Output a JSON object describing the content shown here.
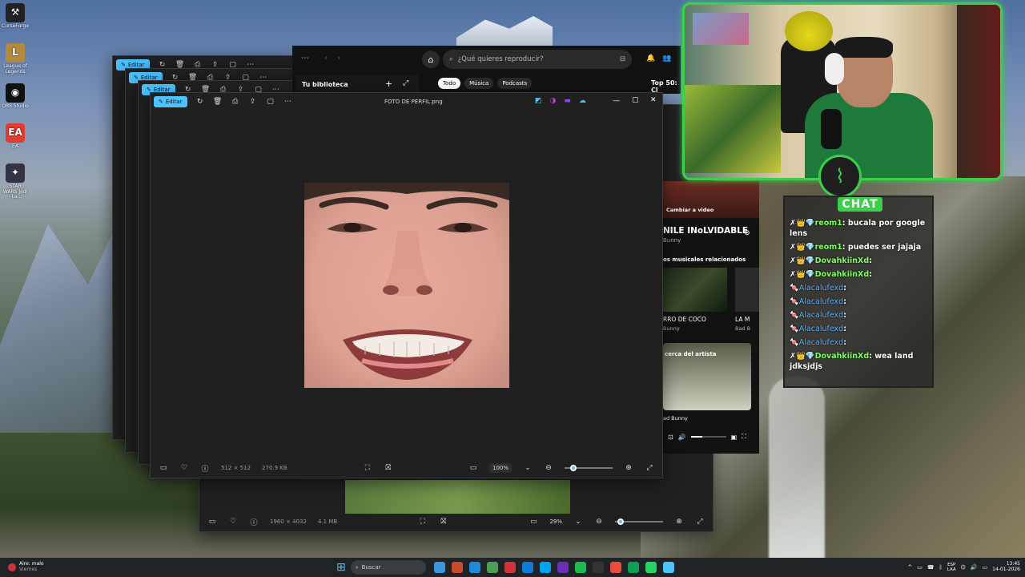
{
  "desktop": {
    "icons": [
      {
        "label": "CurseForge",
        "glyph": "⚒",
        "color": "#222"
      },
      {
        "label": "League of Legends",
        "glyph": "L",
        "color": "#b38b3e"
      },
      {
        "label": "OBS Studio",
        "glyph": "◉",
        "color": "#111"
      },
      {
        "label": "EA",
        "glyph": "EA",
        "color": "#e53b2e"
      },
      {
        "label": "STAR WARS Jedi - La...",
        "glyph": "✦",
        "color": "#334"
      }
    ]
  },
  "viewer_front": {
    "edit_label": "Editar",
    "title": "FOTO DE PERFIL.png",
    "dimensions": "512 × 512",
    "size": "270.9 KB",
    "zoom": "100%",
    "zoom_level": 0.12
  },
  "viewer_back": {
    "dimensions": "1960 × 4032",
    "size": "4.1 MB",
    "zoom": "29%",
    "zoom_level": 0.05
  },
  "viewer_stack_edit": [
    "Editar",
    "Editar",
    "Editar"
  ],
  "spotify": {
    "search_placeholder": "¿Qué quieres reproducir?",
    "library": "Tu biblioteca",
    "chips": [
      "Todo",
      "Música",
      "Podcasts"
    ],
    "top50": "Top 50: Cl",
    "change_video": "Cambiar a video",
    "song_title": "NILE INoLVIDABLE",
    "artist": "Bunny",
    "related": "os musicales relacionados",
    "card1_title": "RRO DE COCO",
    "card1_artist": "Bunny",
    "card2_title": "LA M",
    "card2_artist": "Bad B",
    "about_artist": "cerca del artista",
    "footer_artist": "ad Bunny"
  },
  "chat": {
    "title": "CHAT",
    "messages": [
      {
        "badges": "✗👑💎",
        "user": "reom1",
        "text": ": bucala por google lens",
        "color": "green"
      },
      {
        "badges": "✗👑💎",
        "user": "reom1",
        "text": ": puedes ser jajaja",
        "color": "green"
      },
      {
        "badges": "✗👑💎",
        "user": "DovahkiinXd",
        "text": ": ",
        "color": "green"
      },
      {
        "badges": "✗👑💎",
        "user": "DovahkiinXd",
        "text": ": ",
        "color": "green"
      },
      {
        "badges": "🍬",
        "user": "Alacalufexd",
        "text": ": ",
        "color": "blue"
      },
      {
        "badges": "🍬",
        "user": "Alacalufexd",
        "text": ": ",
        "color": "blue"
      },
      {
        "badges": "🍬",
        "user": "Alacalufexd",
        "text": ": ",
        "color": "blue"
      },
      {
        "badges": "🍬",
        "user": "Alacalufexd",
        "text": ": ",
        "color": "blue"
      },
      {
        "badges": "🍬",
        "user": "Alacalufexd",
        "text": ": ",
        "color": "blue"
      },
      {
        "badges": "✗👑💎",
        "user": "DovahkiinXd",
        "text": ": wea land jdksjdjs",
        "color": "green"
      }
    ]
  },
  "taskbar": {
    "weather_temp": "Aire: malo",
    "weather_day": "Viernes",
    "search": "Buscar",
    "lang1": "ESP",
    "lang2": "LAA",
    "time": "13:45",
    "date": "14-01-2026",
    "apps": [
      "#3a96dd",
      "#c94b2a",
      "#1f8ad8",
      "#4b9e52",
      "#d13438",
      "#0f7bd8",
      "#00a2ed",
      "#6b2fba",
      "#1db954",
      "#333",
      "#e74c3c",
      "#0f9d58",
      "#25d366",
      "#4cc2ff"
    ]
  }
}
